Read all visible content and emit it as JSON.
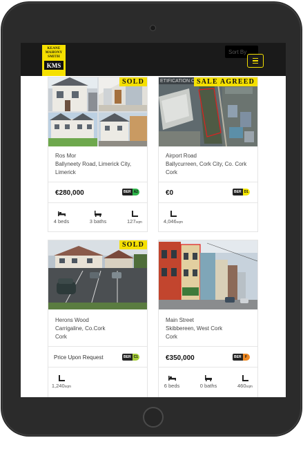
{
  "header": {
    "logo_line1": "KEANE",
    "logo_line2": "MAHONY",
    "logo_line3": "SMITH",
    "logo_mark": "KMS",
    "sort_label": "Sort By",
    "menu_icon": "hamburger-menu-icon",
    "accent_color": "#f5e000"
  },
  "listings": [
    {
      "badge": "SOLD",
      "address_line1": "Ros Mor",
      "address_line2": "Ballyneety Road, Limerick City,",
      "address_line3": "Limerick",
      "price": "€280,000",
      "ber_label": "BER",
      "ber_rating": "A2",
      "ber_color": "#2fb34a",
      "beds": "4 beds",
      "baths": "3 baths",
      "area": "127",
      "area_unit": "sqm"
    },
    {
      "badge": "SALE AGREED",
      "overlay_text": "ETIFICATION ONLY",
      "address_line1": "Airport Road",
      "address_line2": "Ballycurreen, Cork City, Co. Cork",
      "address_line3": "Cork",
      "price": "€0",
      "ber_label": "BER",
      "ber_rating": "D1",
      "ber_color": "#f3e600",
      "area": "4,046",
      "area_unit": "sqm"
    },
    {
      "badge": "SOLD",
      "address_line1": "Herons Wood",
      "address_line2": "Carrigaline, Co.Cork",
      "address_line3": "Cork",
      "price": "Price Upon Request",
      "ber_label": "BER",
      "ber_rating": "C1",
      "ber_color": "#a8cf3a",
      "area": "1,240",
      "area_unit": "sqm"
    },
    {
      "address_line1": "Main Street",
      "address_line2": "Skibbereen, West Cork",
      "address_line3": "Cork",
      "price": "€350,000",
      "ber_label": "BER",
      "ber_rating": "F",
      "ber_color": "#f08a24",
      "beds": "6 beds",
      "baths": "0 baths",
      "area": "460",
      "area_unit": "sqm"
    }
  ]
}
